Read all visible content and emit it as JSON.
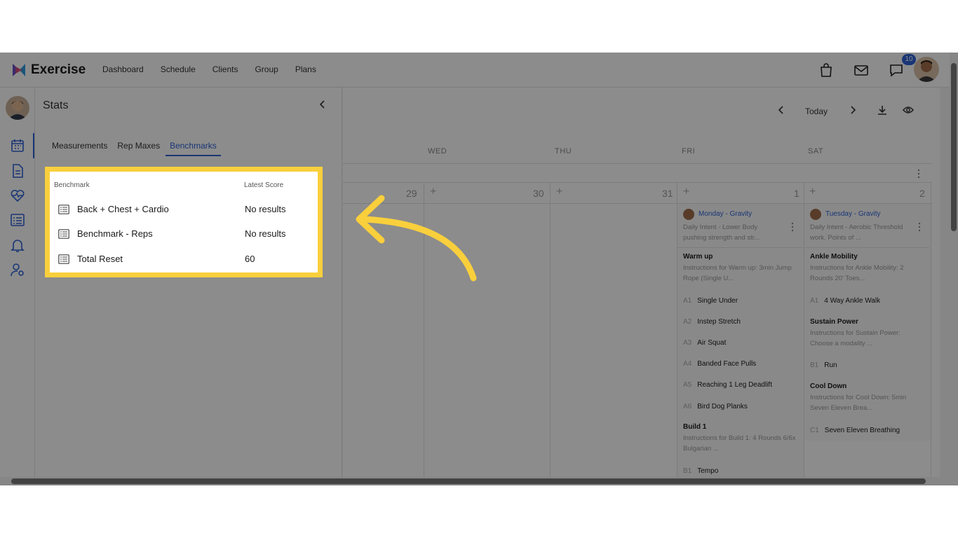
{
  "header": {
    "brand": "Exercise",
    "nav": [
      "Dashboard",
      "Schedule",
      "Clients",
      "Group",
      "Plans"
    ],
    "notifications_count": "10"
  },
  "stats": {
    "title": "Stats",
    "tabs": [
      "Measurements",
      "Rep Maxes",
      "Benchmarks"
    ],
    "active_tab": "Benchmarks",
    "columns": [
      "Benchmark",
      "Latest Score"
    ],
    "rows": [
      {
        "name": "Back + Chest + Cardio",
        "score": "No results"
      },
      {
        "name": "Benchmark - Reps",
        "score": "No results"
      },
      {
        "name": "Total Reset",
        "score": "60"
      }
    ]
  },
  "calendar": {
    "today_label": "Today",
    "days": [
      "WED",
      "THU",
      "FRI",
      "SAT"
    ],
    "dates": [
      "29",
      "30",
      "31",
      "1",
      "2"
    ],
    "friday": {
      "program": "Monday - Gravity",
      "intent": "Daily Intent - Lower Body pushing strength and str...",
      "sections": [
        {
          "title": "Warm up",
          "desc": "Instructions for Warm up: 3min Jump Rope (Single U...",
          "items": [
            {
              "code": "A1",
              "name": "Single Under"
            },
            {
              "code": "A2",
              "name": "Instep Stretch"
            },
            {
              "code": "A3",
              "name": "Air Squat"
            },
            {
              "code": "A4",
              "name": "Banded Face Pulls"
            },
            {
              "code": "A5",
              "name": "Reaching 1 Leg Deadlift"
            },
            {
              "code": "A6",
              "name": "Bird Dog Planks"
            }
          ]
        },
        {
          "title": "Build 1",
          "desc": "Instructions for Build 1: 4 Rounds 6/6x Bulgarian ...",
          "items": [
            {
              "code": "B1",
              "name": "Tempo"
            }
          ]
        }
      ]
    },
    "saturday": {
      "program": "Tuesday - Gravity",
      "intent": "Daily Intent - Aerobic Threshold work. Points of ...",
      "sections": [
        {
          "title": "Ankle Mobility",
          "desc": "Instructions for Ankle Mobility: 2 Rounds 20' Toes...",
          "items": [
            {
              "code": "A1",
              "name": "4 Way Ankle Walk"
            }
          ]
        },
        {
          "title": "Sustain Power",
          "desc": "Instructions for Sustain Power: Choose a modality ...",
          "items": [
            {
              "code": "B1",
              "name": "Run"
            }
          ]
        },
        {
          "title": "Cool Down",
          "desc": "Instructions for Cool Down: 5min Seven Eleven Brea...",
          "items": [
            {
              "code": "C1",
              "name": "Seven Eleven Breathing"
            }
          ]
        }
      ]
    }
  },
  "colors": {
    "accent": "#2f63d6",
    "highlight": "#f9cf3c",
    "overlay": "rgba(0,0,0,0.45)"
  }
}
